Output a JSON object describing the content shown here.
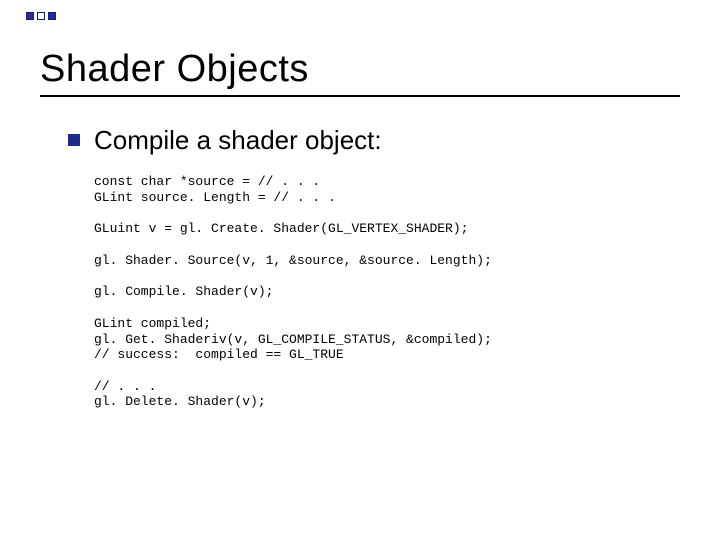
{
  "title": "Shader Objects",
  "bullet": "Compile a shader object:",
  "code": {
    "b1": "const char *source = // . . .\nGLint source. Length = // . . .",
    "b2": "GLuint v = gl. Create. Shader(GL_VERTEX_SHADER);",
    "b3": "gl. Shader. Source(v, 1, &source, &source. Length);",
    "b4": "gl. Compile. Shader(v);",
    "b5": "GLint compiled;\ngl. Get. Shaderiv(v, GL_COMPILE_STATUS, &compiled);\n// success:  compiled == GL_TRUE",
    "b6": "// . . .\ngl. Delete. Shader(v);"
  }
}
